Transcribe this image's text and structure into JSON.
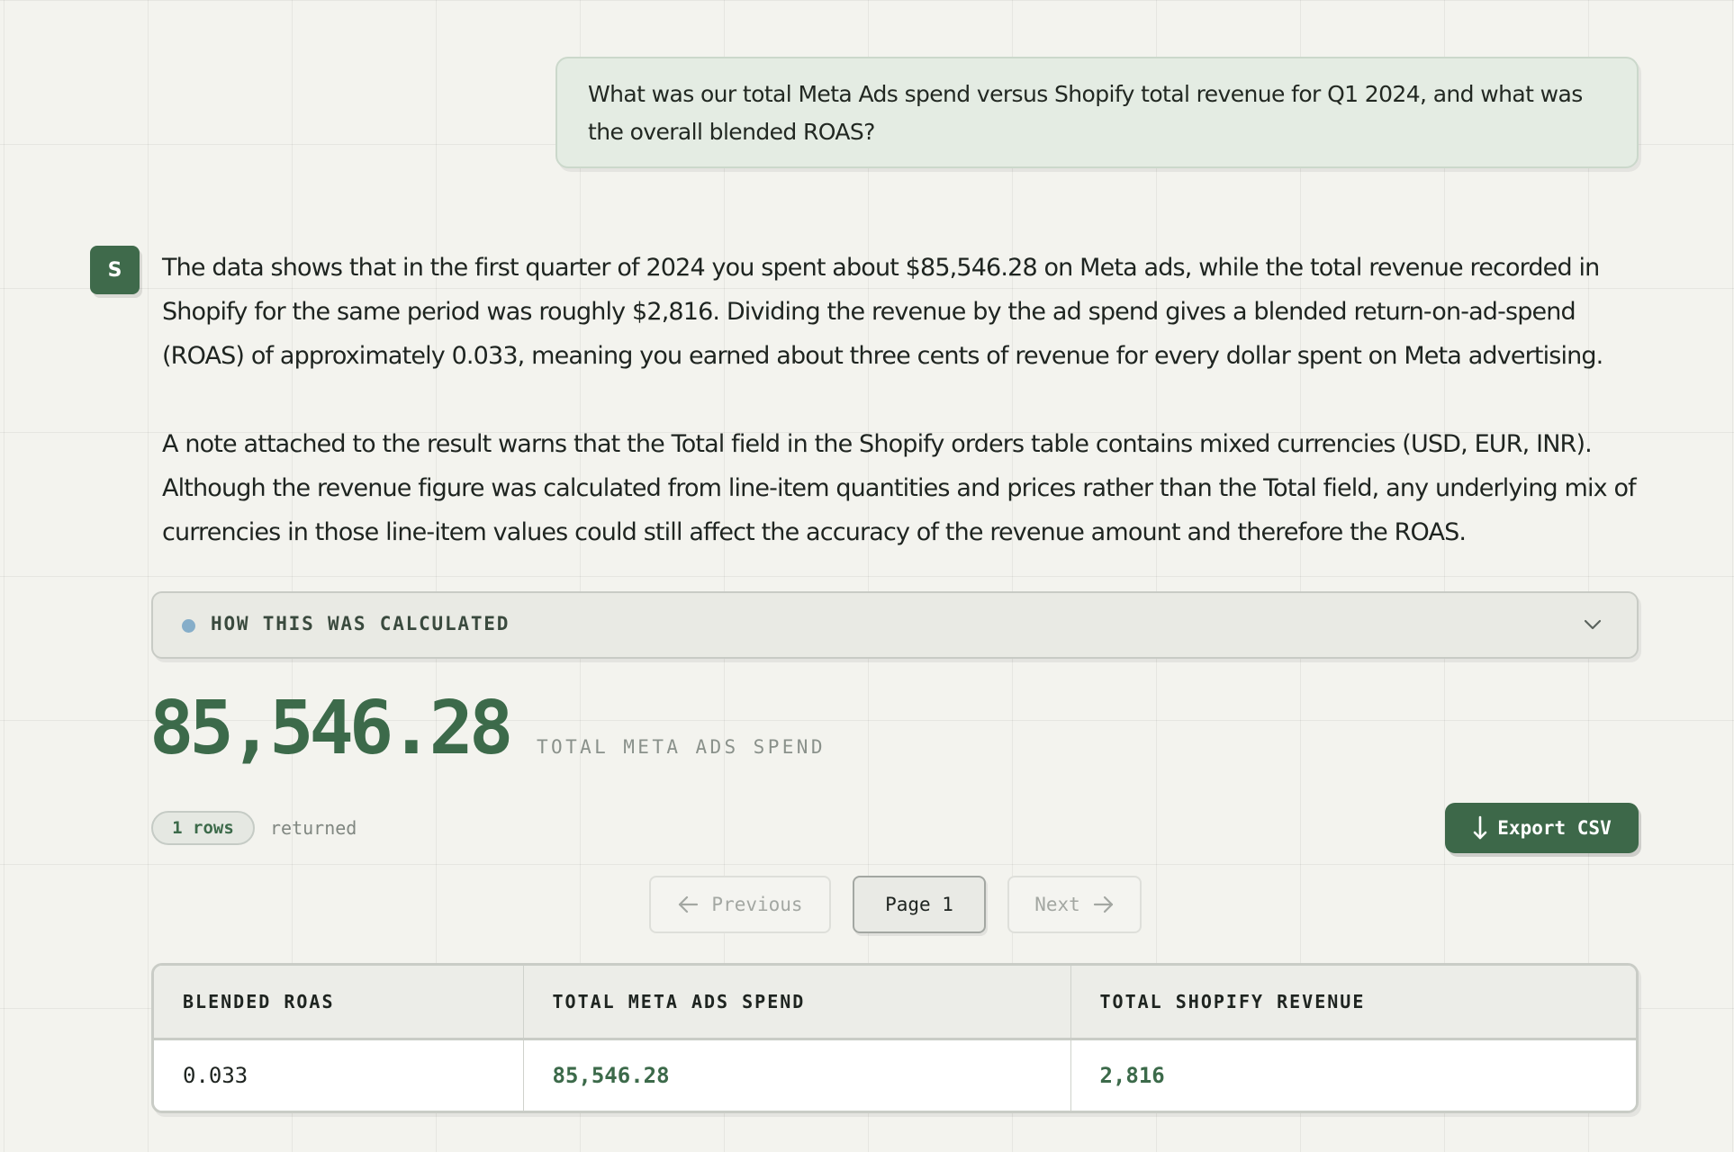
{
  "user_message": {
    "text": "What was our total Meta Ads spend versus Shopify total revenue for Q1 2024, and what was the overall blended ROAS?"
  },
  "assistant": {
    "avatar_letter": "S",
    "paragraphs": [
      "The data shows that in the first quarter of 2024 you spent about $85,546.28 on Meta ads, while the total revenue recorded in Shopify for the same period was roughly $2,816. Dividing the revenue by the ad spend gives a blended return-on-ad-spend (ROAS) of approximately 0.033, meaning you earned about three cents of revenue for every dollar spent on Meta advertising.",
      "A note attached to the result warns that the Total field in the Shopify orders table contains mixed currencies (USD, EUR, INR). Although the revenue figure was calculated from line-item quantities and prices rather than the Total field, any underlying mix of currencies in those line-item values could still affect the accuracy of the revenue amount and therefore the ROAS."
    ]
  },
  "calculation_panel": {
    "label": "HOW THIS WAS CALCULATED",
    "expanded": false,
    "dot_color": "#86aec9"
  },
  "metric": {
    "value": "85,546.28",
    "label": "TOTAL META ADS SPEND"
  },
  "result_meta": {
    "rows_badge": "1 rows",
    "rows_suffix": "returned",
    "export_label": "Export CSV"
  },
  "pagination": {
    "previous_label": "Previous",
    "page_label": "Page 1",
    "next_label": "Next",
    "previous_enabled": false,
    "next_enabled": false
  },
  "table": {
    "columns": [
      "BLENDED ROAS",
      "TOTAL META ADS SPEND",
      "TOTAL SHOPIFY REVENUE"
    ],
    "rows": [
      [
        "0.033",
        "85,546.28",
        "2,816"
      ]
    ]
  },
  "colors": {
    "accent_green": "#3c6a4a",
    "background": "#f3f3ee",
    "user_bubble": "#e4ece3",
    "muted_text": "#8a918b"
  }
}
